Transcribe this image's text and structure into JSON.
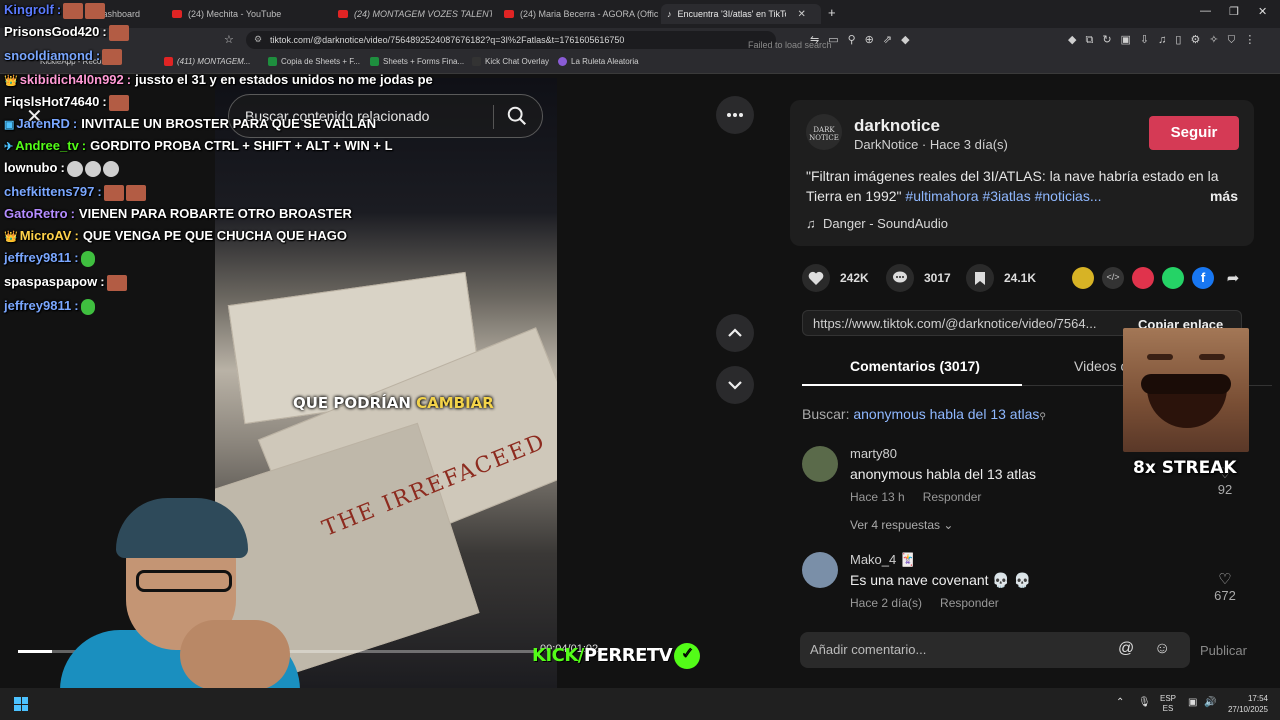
{
  "browser": {
    "tabs": [
      {
        "label": "(24) Mechita - YouTube"
      },
      {
        "label": "(24) MONTAGEM VOZES TALENTIN"
      },
      {
        "label": "(24) Maria Becerra - AGORA (Official"
      },
      {
        "label": "Encuentra '3I/atlas' en TikTok"
      }
    ],
    "first_tab_partial": "Dashboard",
    "url": "tiktok.com/@darknotice/video/7564892524087676182?q=3I%2Fatlas&t=1761605616750",
    "failed_text": "Failed to load search",
    "bookmarks": [
      {
        "label": "KickleApp - Recom..."
      },
      {
        "label": "(411) MONTAGEM..."
      },
      {
        "label": "Copia de Sheets + F..."
      },
      {
        "label": "Sheets + Forms Fina..."
      },
      {
        "label": "Kick Chat Overlay"
      },
      {
        "label": "La Ruleta Aleatoria"
      }
    ]
  },
  "chat": [
    {
      "user": "Kingrolf",
      "text": "",
      "color": "#5b7bff",
      "emotes": 2
    },
    {
      "user": "PrisonsGod420",
      "text": "",
      "color": "#ffffff",
      "emotes": 1
    },
    {
      "user": "snooldiamond",
      "text": "",
      "color": "#7aa7ff",
      "emotes": 1
    },
    {
      "user": "skibidich4l0n992",
      "text": "jussto el 31 y en estados unidos no me jodas pe",
      "color": "#ff9ad5",
      "badge": "crown"
    },
    {
      "user": "FiqslsHot74640",
      "text": "",
      "color": "#ffffff",
      "emotes": 1
    },
    {
      "user": "JarenRD",
      "text": "INVITALE UN BROSTER PARA QUE SE VALLAN",
      "color": "#7aa7ff",
      "badge": "sub"
    },
    {
      "user": "Andree_tv",
      "text": "GORDITO PROBA CTRL + SHIFT + ALT + WIN + L",
      "color": "#53fc18",
      "badge": "multi"
    },
    {
      "user": "lownubo",
      "text": "",
      "color": "#ffffff",
      "emotes": 3,
      "ghost": true
    },
    {
      "user": "chefkittens797",
      "text": "",
      "color": "#7aa7ff",
      "emotes": 2
    },
    {
      "user": "GatoRetro",
      "text": "VIENEN PARA ROBARTE OTRO BROASTER",
      "color": "#b48cff"
    },
    {
      "user": "MicroAV",
      "text": "QUE VENGA PE QUE CHUCHA QUE HAGO",
      "color": "#ffd24a",
      "badge": "crown"
    },
    {
      "user": "jeffrey9811",
      "text": "",
      "color": "#7aa7ff",
      "emotes": 1,
      "green": true
    },
    {
      "user": "spaspaspapow",
      "text": "",
      "color": "#ffffff",
      "emotes": 1
    },
    {
      "user": "jeffrey9811",
      "text": "",
      "color": "#7aa7ff",
      "emotes": 1,
      "green": true
    }
  ],
  "video": {
    "search_placeholder": "Buscar contenido relacionado",
    "caption_pre": "QUE PODRÍAN ",
    "caption_hl": "CAMBIAR",
    "paper_text": "THE IRREFACEED",
    "time": "00:04/01:02",
    "progress": 0.065
  },
  "post": {
    "avatar_text": "DARK NOTICE",
    "username": "darknotice",
    "subline": "DarkNotice · Hace 3 día(s)",
    "follow_label": "Seguir",
    "desc_text": "\"Filtran imágenes reales del 3I/ATLAS: la nave habría estado en la Tierra en 1992\" ",
    "desc_tags": "#ultimahora #3iatlas #noticias...",
    "more_label": "más",
    "music": "Danger - SoundAudio",
    "likes": "242K",
    "comments_count": "3017",
    "saves": "24.1K",
    "link": "https://www.tiktok.com/@darknotice/video/7564...",
    "copy_label": "Copiar enlace",
    "tab_comments": "Comentarios (3017)",
    "tab_videos": "Videos c",
    "search_label": "Buscar: ",
    "search_query": "anonymous habla del 13 atlas"
  },
  "comments": [
    {
      "user": "marty80",
      "text": "anonymous habla del 13 atlas",
      "time": "Hace 13 h",
      "reply": "Responder",
      "likes": "92",
      "replies": "Ver 4 respuestas"
    },
    {
      "user": "Mako_4 🃏",
      "text": "Es una nave covenant 💀 💀",
      "time": "Hace 2 día(s)",
      "reply": "Responder",
      "likes": "672"
    }
  ],
  "add_comment_placeholder": "Añadir comentario...",
  "publish_label": "Publicar",
  "streak": "8x STREAK",
  "kick_brand": {
    "pre": "KICK/",
    "name": "PERRETV"
  },
  "taskbar": {
    "lang1": "ESP",
    "lang2": "ES",
    "time": "17:54",
    "date": "27/10/2025"
  },
  "colors": {
    "follow": "#d53a55",
    "kick": "#53fc18",
    "tag": "#8fb8ff"
  }
}
